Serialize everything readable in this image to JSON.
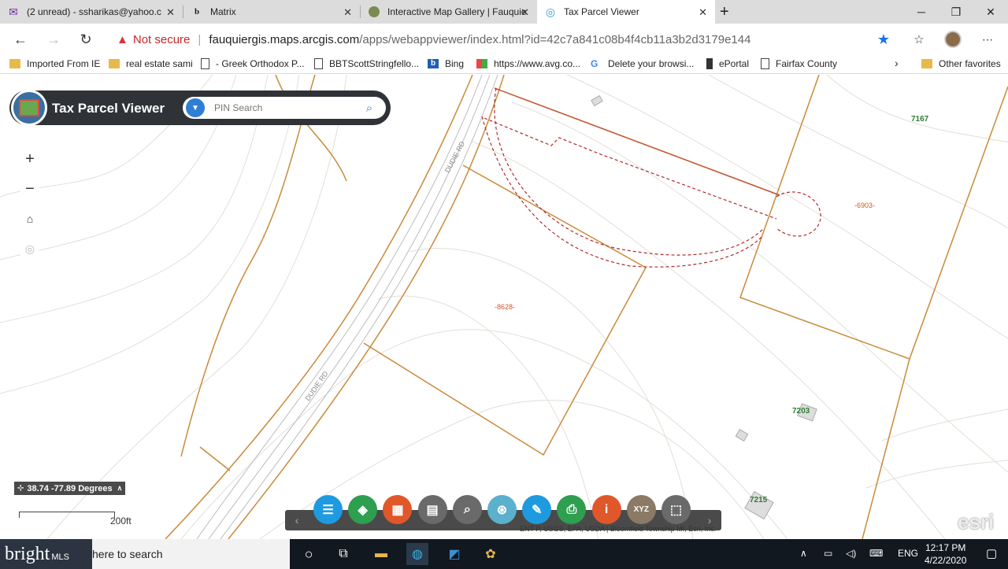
{
  "browser": {
    "tabs": [
      {
        "label": "(2 unread) - ssharikas@yahoo.c",
        "icon": "mail-icon"
      },
      {
        "label": "Matrix",
        "icon": "b-icon"
      },
      {
        "label": "Interactive Map Gallery | Fauquie",
        "icon": "globe-icon"
      },
      {
        "label": "Tax Parcel Viewer",
        "icon": "app-icon"
      }
    ],
    "new_tab": "+",
    "security_label": "Not secure",
    "url_host": "fauquiergis.maps.arcgis.com",
    "url_path": "/apps/webappviewer/index.html?id=42c7a841c08b4f4cb11a3b2d3179e144",
    "bookmarks": [
      {
        "label": "Imported From IE",
        "icon": "folder-icon"
      },
      {
        "label": "real estate sami",
        "icon": "folder-icon"
      },
      {
        "label": "- Greek Orthodox P...",
        "icon": "page-icon"
      },
      {
        "label": "BBTScottStringfello...",
        "icon": "page-icon"
      },
      {
        "label": "Bing",
        "icon": "bing-icon"
      },
      {
        "label": "https://www.avg.co...",
        "icon": "avg-icon"
      },
      {
        "label": "Delete your browsi...",
        "icon": "google-icon"
      },
      {
        "label": "ePortal",
        "icon": "eportal-icon"
      },
      {
        "label": "Fairfax County",
        "icon": "page-icon"
      }
    ],
    "other_favorites": "Other favorites"
  },
  "app": {
    "title": "Tax Parcel Viewer",
    "search_placeholder": "PIN Search"
  },
  "map": {
    "road_labels": [
      "DUDIE RD",
      "DUDIE RD"
    ],
    "parcel_labels": [
      "-8628-",
      "-6903-"
    ],
    "address_labels": [
      "7167",
      "7203",
      "7215"
    ],
    "coords": "38.74 -77.89 Degrees",
    "scale": "200ft",
    "attribution": "ENT P, USGS, EPA, USDA | Bloomfield Township MI, Esri, Inc.",
    "esri": "esri"
  },
  "toolbar": {
    "tools": [
      {
        "name": "legend-tool",
        "color": "#1e9be0",
        "glyph": "☰"
      },
      {
        "name": "layers-tool",
        "color": "#2e9e4f",
        "glyph": "◈"
      },
      {
        "name": "basemap-tool",
        "color": "#e0572a",
        "glyph": "▦"
      },
      {
        "name": "attribute-table-tool",
        "color": "#6a6a6a",
        "glyph": "▤"
      },
      {
        "name": "query-tool",
        "color": "#6a6a6a",
        "glyph": "⌕"
      },
      {
        "name": "share-tool",
        "color": "#5bb0cc",
        "glyph": "⊛"
      },
      {
        "name": "measure-tool",
        "color": "#1e9be0",
        "glyph": "✎"
      },
      {
        "name": "print-tool",
        "color": "#2e9e4f",
        "glyph": "⎙"
      },
      {
        "name": "about-tool",
        "color": "#e0572a",
        "glyph": "i"
      },
      {
        "name": "coordinate-tool",
        "color": "#8a7a66",
        "glyph": "XYZ"
      },
      {
        "name": "select-tool",
        "color": "#6a6a6a",
        "glyph": "⬚"
      }
    ]
  },
  "taskbar": {
    "brand": "bright",
    "brand_suffix": "MLS",
    "search_text": "here to search",
    "lang": "ENG",
    "time": "12:17 PM",
    "date": "4/22/2020"
  }
}
